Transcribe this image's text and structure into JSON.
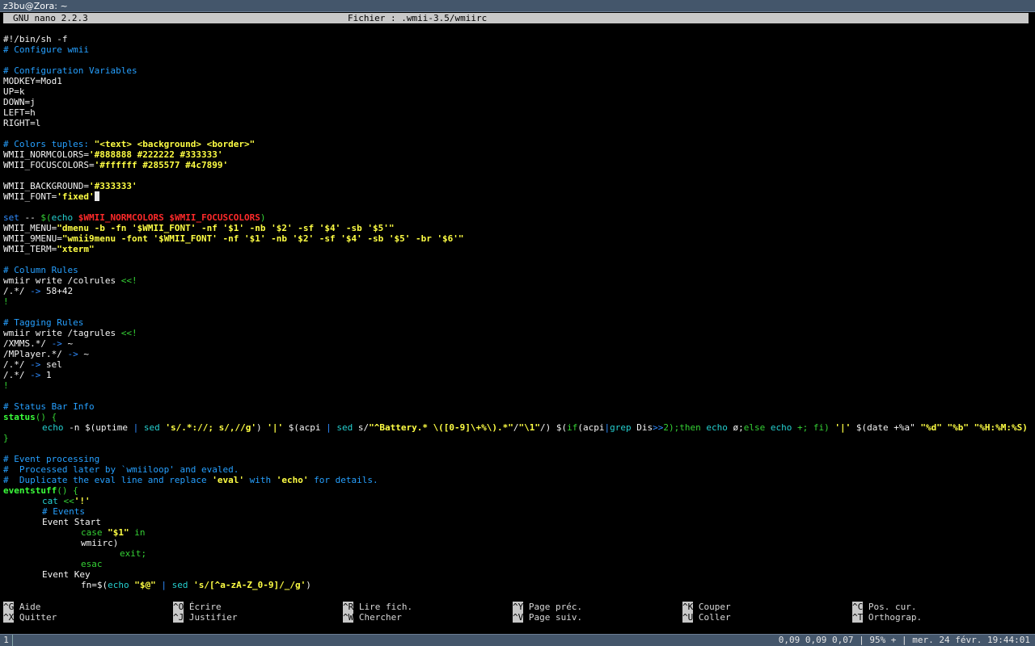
{
  "window": {
    "title": "z3bu@Zora: ~"
  },
  "nano": {
    "version": "GNU nano 2.2.3",
    "file": "Fichier : .wmii-3.5/wmiirc"
  },
  "shortcuts": [
    {
      "key": "^G",
      "label": "Aide"
    },
    {
      "key": "^X",
      "label": "Quitter"
    },
    {
      "key": "^O",
      "label": "Écrire"
    },
    {
      "key": "^J",
      "label": "Justifier"
    },
    {
      "key": "^R",
      "label": "Lire fich."
    },
    {
      "key": "^W",
      "label": "Chercher"
    },
    {
      "key": "^Y",
      "label": "Page préc."
    },
    {
      "key": "^V",
      "label": "Page suiv."
    },
    {
      "key": "^K",
      "label": "Couper"
    },
    {
      "key": "^U",
      "label": "Coller"
    },
    {
      "key": "^C",
      "label": "Pos. cur."
    },
    {
      "key": "^T",
      "label": "Orthograp."
    }
  ],
  "status_bar": {
    "tag": "1",
    "info": "0,09 0,09 0,07 | 95% + | mer. 24 févr. 19:44:01"
  },
  "code": {
    "l1": "#!/bin/sh -f",
    "l2": "# Configure wmii",
    "l4": "# Configuration Variables",
    "l5": "MODKEY=Mod1",
    "l6": "UP=k",
    "l7": "DOWN=j",
    "l8": "LEFT=h",
    "l9": "RIGHT=l",
    "l11a": "# Colors tuples: ",
    "l11b": "\"<text> <background> <border>\"",
    "l12a": "WMII_NORMCOLORS=",
    "l12b": "'#888888 #222222 #333333'",
    "l13a": "WMII_FOCUSCOLORS=",
    "l13b": "'#ffffff #285577 #4c7899'",
    "l15a": "WMII_BACKGROUND=",
    "l15b": "'#333333'",
    "l16a": "WMII_FONT=",
    "l16b": "'fixed'",
    "l18a": "set",
    "l18b": " -- ",
    "l18c": "$(",
    "l18d": "echo",
    "l18e": " $WMII_NORMCOLORS $WMII_FOCUSCOLORS",
    "l18f": ")",
    "l19a": "WMII_MENU=",
    "l19b": "\"dmenu -b -fn '$WMII_FONT' -nf '$1' -nb '$2' -sf '$4' -sb '$5'\"",
    "l20a": "WMII_9MENU=",
    "l20b": "\"wmii9menu -font '$WMII_FONT' -nf '$1' -nb '$2' -sf '$4' -sb '$5' -br '$6'\"",
    "l21a": "WMII_TERM=",
    "l21b": "\"xterm\"",
    "l23": "# Column Rules",
    "l24a": "wmiir write /colrules ",
    "l24b": "<<!",
    "l25a": "/.*/ ",
    "l25b": "->",
    "l25c": " 58+42",
    "l26": "!",
    "l28": "# Tagging Rules",
    "l29a": "wmiir write /tagrules ",
    "l29b": "<<!",
    "l30a": "/XMMS.*/ ",
    "l30b": "->",
    "l30c": " ~",
    "l31a": "/MPlayer.*/ ",
    "l31b": "->",
    "l31c": " ~",
    "l32a": "/.*/ ",
    "l32b": "->",
    "l32c": " sel",
    "l33a": "/.*/ ",
    "l33b": "->",
    "l33c": " 1",
    "l34": "!",
    "l36": "# Status Bar Info",
    "l37a": "status",
    "l37b": "() {",
    "l38": [
      {
        "t": "echo",
        "c": "cy"
      },
      {
        "t": " -n ",
        "c": "v"
      },
      {
        "t": "$(",
        "c": "v"
      },
      {
        "t": "uptime",
        "c": "v"
      },
      {
        "t": " | ",
        "c": "k"
      },
      {
        "t": "sed",
        "c": "cy"
      },
      {
        "t": " ",
        "c": "v"
      },
      {
        "t": "'s/.*://; s/,//g'",
        "c": "s"
      },
      {
        "t": ") ",
        "c": "v"
      },
      {
        "t": "'|'",
        "c": "s"
      },
      {
        "t": " $(",
        "c": "v"
      },
      {
        "t": "acpi",
        "c": "v"
      },
      {
        "t": " | ",
        "c": "k"
      },
      {
        "t": "sed",
        "c": "cy"
      },
      {
        "t": " s/",
        "c": "v"
      },
      {
        "t": "\"^Battery.* \\([0-9]\\+%\\).*\"",
        "c": "s"
      },
      {
        "t": "/",
        "c": "v"
      },
      {
        "t": "\"\\1\"",
        "c": "s"
      },
      {
        "t": "/) ",
        "c": "v"
      },
      {
        "t": "$(",
        "c": "v"
      },
      {
        "t": "if",
        "c": "g"
      },
      {
        "t": "(acpi",
        "c": "v"
      },
      {
        "t": "|",
        "c": "k"
      },
      {
        "t": "grep",
        "c": "cy"
      },
      {
        "t": " Dis",
        "c": "v"
      },
      {
        "t": ">>",
        "c": "k"
      },
      {
        "t": "2);",
        "c": "g"
      },
      {
        "t": "then ",
        "c": "g"
      },
      {
        "t": "echo",
        "c": "cy"
      },
      {
        "t": " ø;",
        "c": "v"
      },
      {
        "t": "else ",
        "c": "g"
      },
      {
        "t": "echo",
        "c": "cy"
      },
      {
        "t": " +; fi) ",
        "c": "g"
      },
      {
        "t": "'|'",
        "c": "s"
      },
      {
        "t": " $(date +%a\" ",
        "c": "v"
      },
      {
        "t": "\"%d\"",
        "c": "s"
      },
      {
        "t": " ",
        "c": "v"
      },
      {
        "t": "\"%b\"",
        "c": "s"
      },
      {
        "t": " ",
        "c": "v"
      },
      {
        "t": "\"%H:%M:%S)",
        "c": "s"
      }
    ],
    "l39": "}",
    "l41": "# Event processing",
    "l42": "#  Processed later by `wmiiloop' and evaled.",
    "l43a": "#  Duplicate the eval line and replace ",
    "l43b": "'eval'",
    "l43c": " with ",
    "l43d": "'echo'",
    "l43e": " for details.",
    "l44a": "eventstuff",
    "l44b": "() {",
    "l45a": "cat",
    "l45b": " <<",
    "l45c": "'!'",
    "l46": "# Events",
    "l47": "Event Start",
    "l48a": "case",
    "l48b": " \"$1\"",
    "l48c": " in",
    "l49": "wmiirc)",
    "l50": "exit;",
    "l51": "esac",
    "l52": "Event Key",
    "l53a": "fn=$(",
    "l53b": "echo",
    "l53c": " \"$@\"",
    "l53d": " | ",
    "l53e": "sed",
    "l53f": " 's/[^a-zA-Z_0-9]/_/g'",
    "l53g": ")"
  }
}
